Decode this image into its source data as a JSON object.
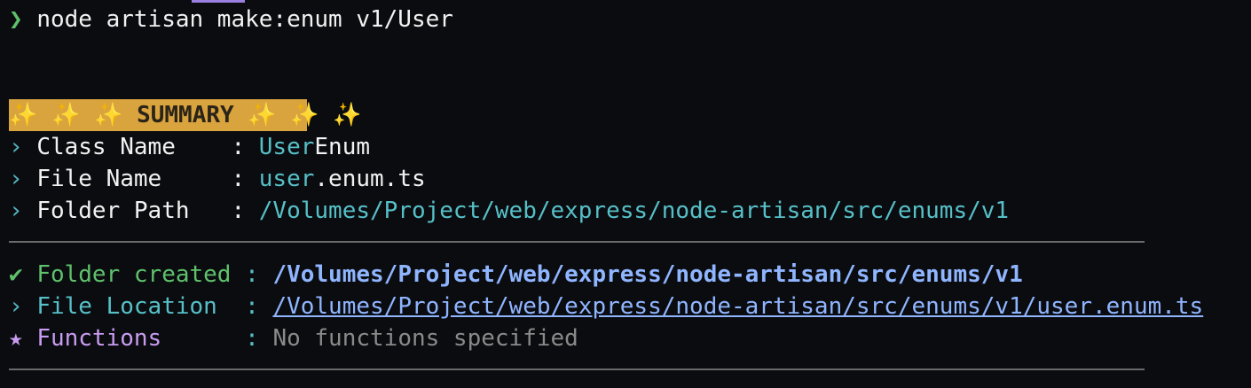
{
  "prompt": {
    "symbol": "❯",
    "command": "node artisan make:enum v1/User"
  },
  "summary": {
    "badge_left": "✨ ✨ ✨ ",
    "title": "SUMMARY",
    "badge_right": " ✨ ✨ ✨"
  },
  "details": {
    "bullet": "›",
    "class_name_label": "Class Name    ",
    "class_name_prefix": "User",
    "class_name_suffix": "Enum",
    "file_name_label": "File Name     ",
    "file_name_prefix": "user",
    "file_name_suffix": ".enum.ts",
    "folder_path_label": "Folder Path   ",
    "folder_path_value": "/Volumes/Project/web/express/node-artisan/src/enums/v1",
    "separator": ": "
  },
  "results": {
    "check_symbol": "✔",
    "folder_created_label": "Folder created ",
    "folder_created_value": "/Volumes/Project/web/express/node-artisan/src/enums/v1",
    "file_location_symbol": "›",
    "file_location_label": "File Location  ",
    "file_location_value": "/Volumes/Project/web/express/node-artisan/src/enums/v1/user.enum.ts",
    "functions_symbol": "★",
    "functions_label": "Functions      ",
    "functions_value": "No functions specified",
    "separator": ": "
  },
  "colors": {
    "background": "#0b0c10",
    "green": "#5ec16b",
    "cyan": "#56c0c7",
    "blue": "#8fb5ff",
    "purple": "#c89cf0",
    "badge": "#d9a33e",
    "grey": "#8a8a8a"
  }
}
